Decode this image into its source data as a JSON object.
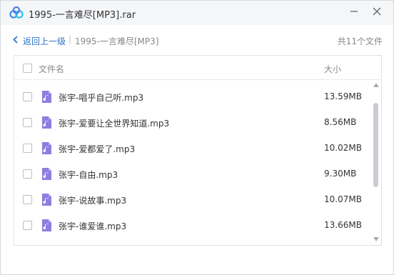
{
  "window": {
    "title": "1995-一言难尽[MP3].rar",
    "icons": {
      "logo": "baidu-netdisk-logo-icon",
      "minimize": "minimize-icon",
      "close": "close-icon"
    }
  },
  "nav": {
    "back_label": "返回上一级",
    "separator": "|",
    "current_folder": "1995-一言难尽[MP3]",
    "file_count": "共11个文件"
  },
  "columns": {
    "name": "文件名",
    "size": "大小"
  },
  "files": [
    {
      "name": "张宇-唱乎自己听.mp3",
      "size": "13.59MB"
    },
    {
      "name": "张宇-爱要让全世界知道.mp3",
      "size": "8.56MB"
    },
    {
      "name": "张宇-爱都爱了.mp3",
      "size": "10.02MB"
    },
    {
      "name": "张宇-自由.mp3",
      "size": "9.30MB"
    },
    {
      "name": "张宇-说故事.mp3",
      "size": "10.07MB"
    },
    {
      "name": "张宇-谁爱谁.mp3",
      "size": "13.66MB"
    }
  ],
  "colors": {
    "accent_link": "#2f74c9",
    "music_icon": "#8b7fe0",
    "titlebar_bg": "#f5f6f8"
  }
}
